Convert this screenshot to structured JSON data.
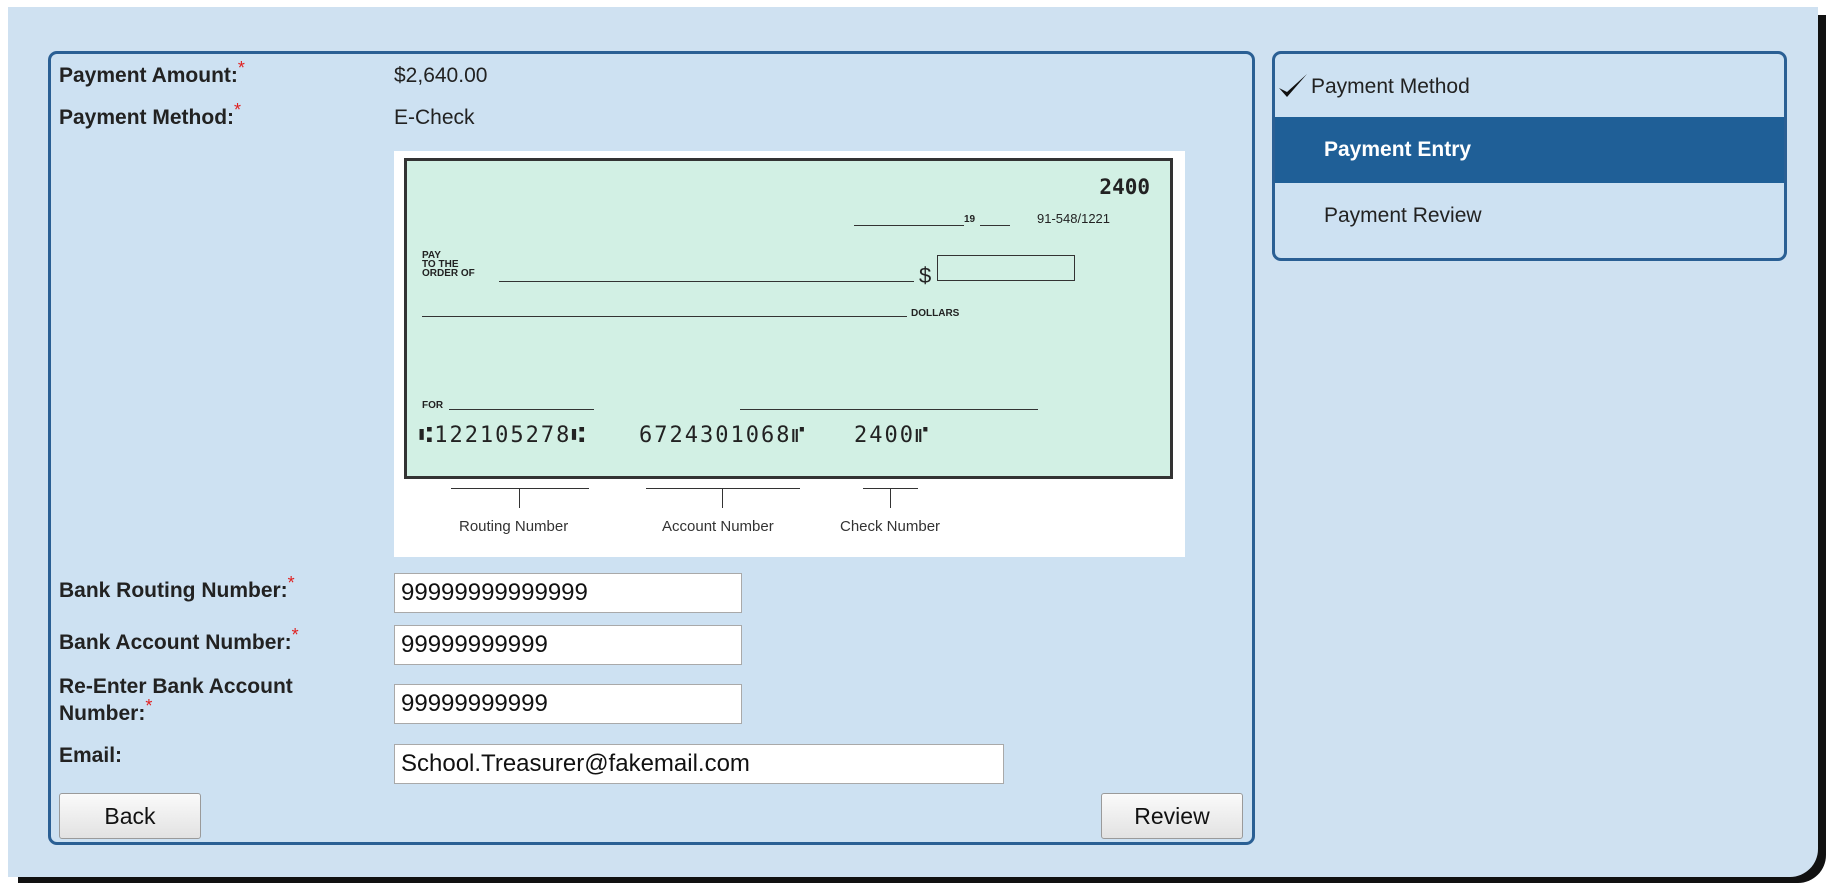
{
  "payment": {
    "amount_label": "Payment Amount:",
    "amount_value": "$2,640.00",
    "method_label": "Payment Method:",
    "method_value": "E-Check",
    "required_mark": "*"
  },
  "check_image": {
    "check_number": "2400",
    "date_suffix": "19",
    "fraction_code": "91-548/1221",
    "pay_to_line1": "PAY",
    "pay_to_line2": "TO THE",
    "pay_to_line3": "ORDER OF",
    "dollar_sign": "$",
    "dollars_label": "DOLLARS",
    "for_label": "FOR",
    "micr_routing": "⑆122105278⑆",
    "micr_account": "6724301068⑈",
    "micr_check": "2400⑈",
    "captions": [
      "Routing Number",
      "Account Number",
      "Check Number"
    ]
  },
  "form": {
    "routing_label": "Bank Routing Number:",
    "routing_value": "99999999999999",
    "account_label": "Bank Account Number:",
    "account_value": "99999999999",
    "reenter_label_1": "Re-Enter Bank Account",
    "reenter_label_2": "Number:",
    "reenter_value": "99999999999",
    "email_label": "Email:",
    "email_value": "School.Treasurer@fakemail.com"
  },
  "buttons": {
    "back": "Back",
    "review": "Review"
  },
  "steps": [
    {
      "label": "Payment Method",
      "state": "completed",
      "icon": "checkmark-icon"
    },
    {
      "label": "Payment Entry",
      "state": "active"
    },
    {
      "label": "Payment Review",
      "state": "pending"
    }
  ],
  "colors": {
    "accent": "#1f5f97",
    "required": "#e02020",
    "background": "#cfe1f1",
    "check_fill": "#d2f0e4"
  }
}
